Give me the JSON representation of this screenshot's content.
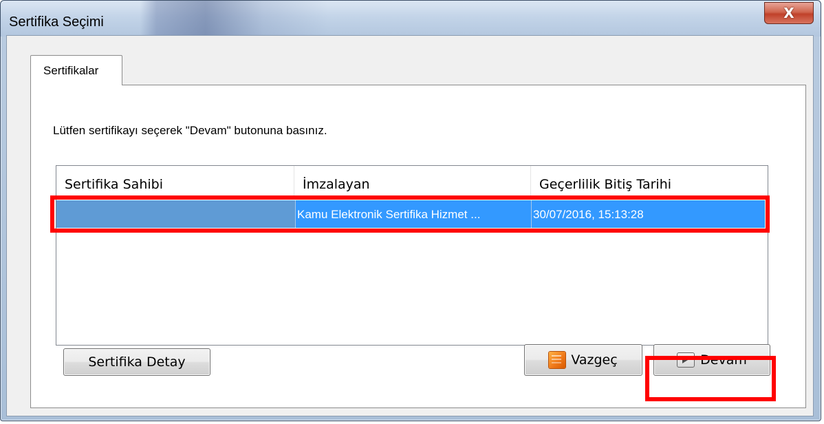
{
  "window": {
    "title": "Sertifika Seçimi",
    "close_label": "X"
  },
  "tabs": [
    {
      "label": "Sertifikalar",
      "active": true
    }
  ],
  "instruction": "Lütfen sertifikayı seçerek \"Devam\" butonuna basınız.",
  "table": {
    "columns": [
      "Sertifika Sahibi",
      "İmzalayan",
      "Geçerlilik Bitiş Tarihi"
    ],
    "rows": [
      {
        "owner": "",
        "issuer": "Kamu Elektronik Sertifika Hizmet ...",
        "expiry": "30/07/2016, 15:13:28",
        "selected": true
      }
    ]
  },
  "buttons": {
    "details": "Sertifika Detay",
    "cancel": "Vazgeç",
    "continue": "Devam"
  },
  "icons": {
    "cancel": "cancel-book-icon",
    "continue": "continue-arrow-icon"
  },
  "colors": {
    "selection": "#3399ff",
    "highlight": "#ff0000"
  }
}
